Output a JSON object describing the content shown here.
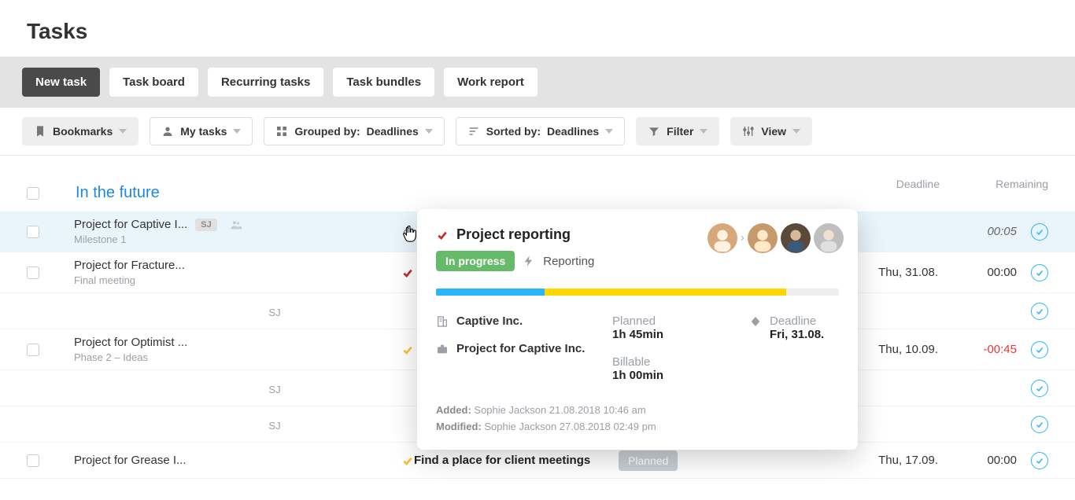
{
  "page": {
    "title": "Tasks"
  },
  "nav": {
    "new_task": "New task",
    "task_board": "Task board",
    "recurring": "Recurring tasks",
    "bundles": "Task bundles",
    "work_report": "Work report"
  },
  "filters": {
    "bookmarks": "Bookmarks",
    "my_tasks": "My tasks",
    "grouped_by_label": "Grouped by:",
    "grouped_by_value": "Deadlines",
    "sorted_by_label": "Sorted by:",
    "sorted_by_value": "Deadlines",
    "filter": "Filter",
    "view": "View"
  },
  "columns": {
    "deadline": "Deadline",
    "remaining": "Remaining"
  },
  "group": {
    "title": "In the future"
  },
  "rows": [
    {
      "project": "Project for Captive I...",
      "sub": "Milestone 1",
      "badge": "SJ",
      "people": true,
      "timer": true,
      "edit": true,
      "status": "red",
      "deadline": "",
      "remaining": "00:05",
      "remaining_italic": true
    },
    {
      "project": "Project for Fracture...",
      "sub": "Final meeting",
      "status": "red",
      "deadline": "Thu, 31.08.",
      "remaining": "00:00"
    },
    {
      "sub_center": "SJ",
      "deadline": "",
      "remaining": ""
    },
    {
      "project": "Project for Optimist ...",
      "sub": "Phase 2 – Ideas",
      "status": "yellow",
      "deadline": "Thu, 10.09.",
      "remaining": "-00:45",
      "remaining_neg": true
    },
    {
      "sub_center": "SJ",
      "deadline": "",
      "remaining": ""
    },
    {
      "sub_center": "SJ",
      "deadline": "",
      "remaining": ""
    },
    {
      "project": "Project for Grease I...",
      "status": "yellow",
      "task_name": "Find a place for client meetings",
      "planned_badge": "Planned",
      "deadline": "Thu, 17.09.",
      "remaining": "00:00"
    }
  ],
  "panel": {
    "title": "Project reporting",
    "status": "In progress",
    "category": "Reporting",
    "company": "Captive Inc.",
    "project": "Project for Captive Inc.",
    "planned_label": "Planned",
    "planned_value": "1h 45min",
    "billable_label": "Billable",
    "billable_value": "1h 00min",
    "deadline_label": "Deadline",
    "deadline_value": "Fri, 31.08.",
    "added_label": "Added:",
    "added_value": "Sophie Jackson 21.08.2018 10:46 am",
    "modified_label": "Modified:",
    "modified_value": "Sophie Jackson 27.08.2018 02:49 pm"
  }
}
